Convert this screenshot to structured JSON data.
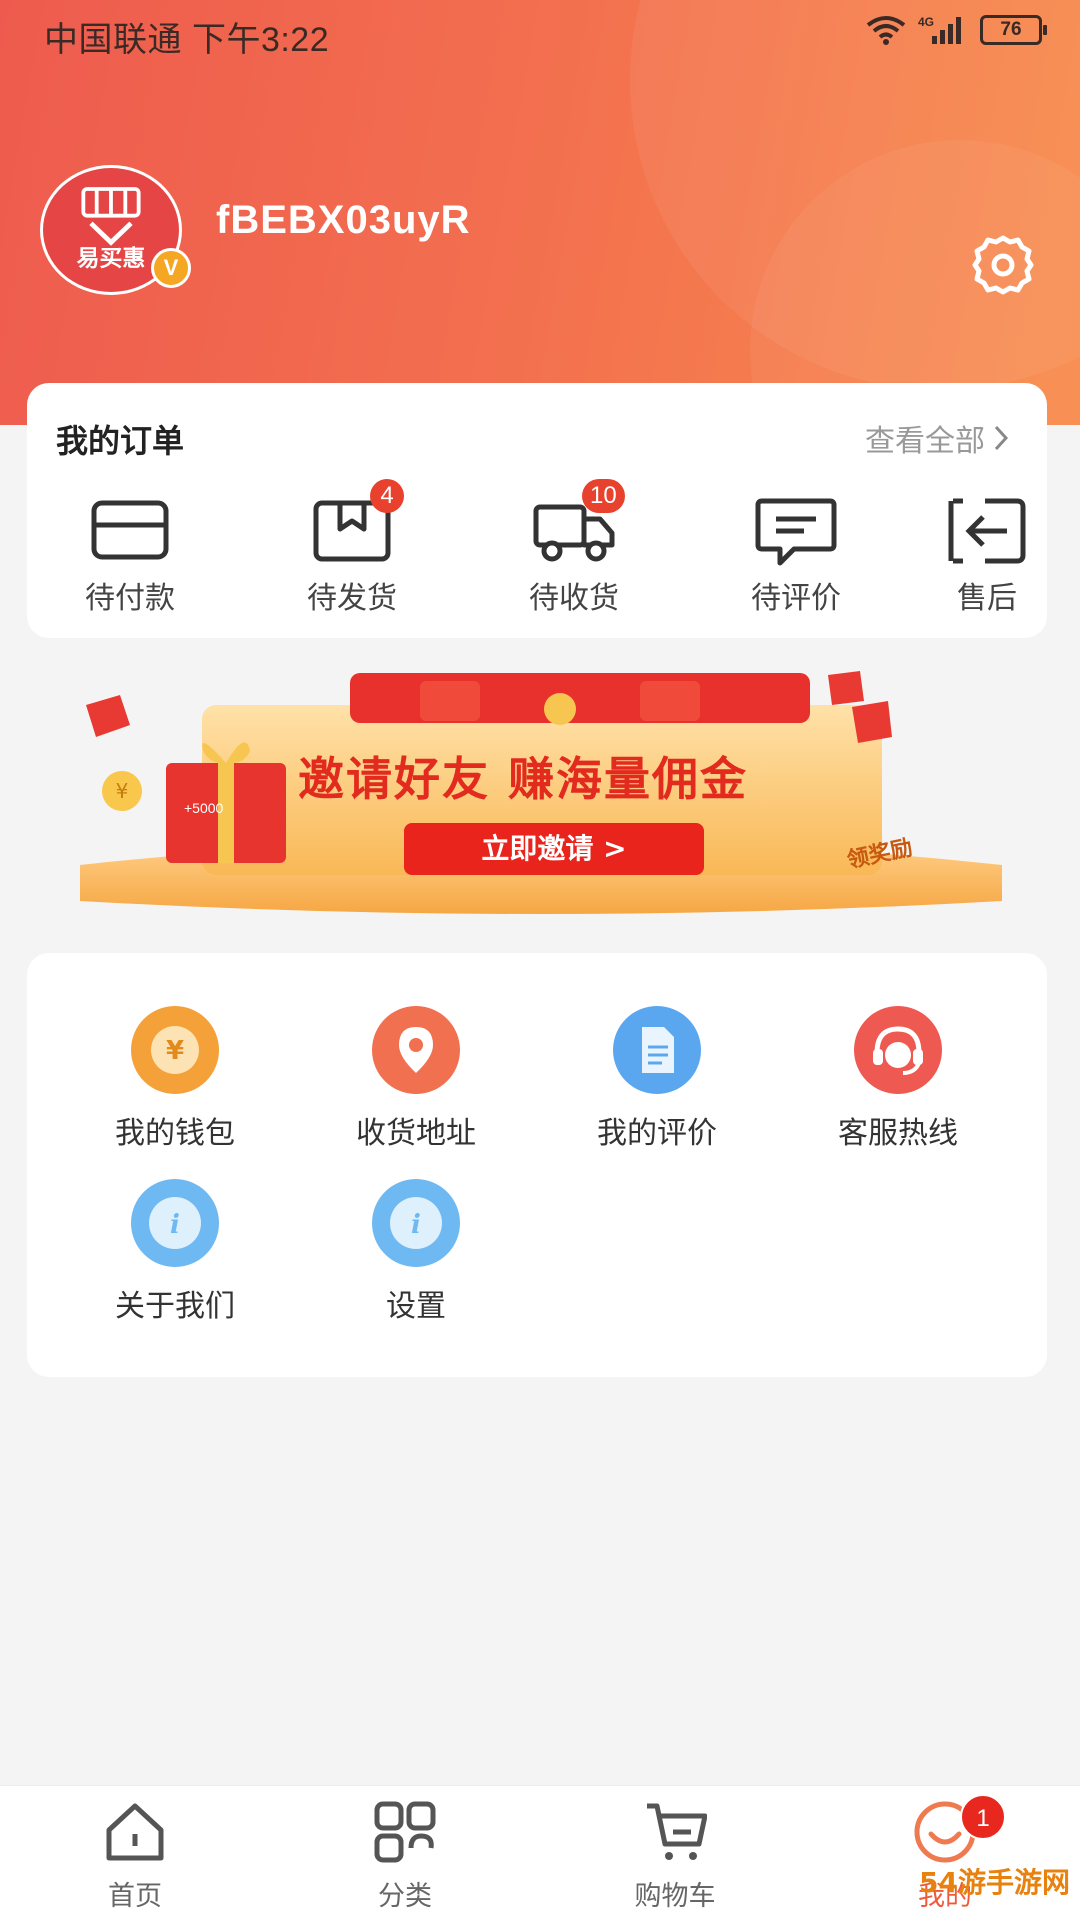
{
  "status_bar": {
    "carrier_time": "中国联通 下午3:22",
    "network": "4G",
    "battery": "76",
    "icons": [
      "wifi-icon",
      "signal-icon",
      "battery-icon"
    ]
  },
  "profile": {
    "avatar_text": "易买惠",
    "vip_badge": "V",
    "username": "fBEBX03uyR",
    "settings_icon": "gear-icon"
  },
  "orders": {
    "title": "我的订单",
    "view_all": "查看全部",
    "items": [
      {
        "label": "待付款",
        "icon": "wallet-card-icon",
        "badge": ""
      },
      {
        "label": "待发货",
        "icon": "package-box-icon",
        "badge": "4"
      },
      {
        "label": "待收货",
        "icon": "delivery-truck-icon",
        "badge": "10"
      },
      {
        "label": "待评价",
        "icon": "comment-icon",
        "badge": ""
      },
      {
        "label": "售后",
        "icon": "return-arrow-icon",
        "badge": ""
      }
    ]
  },
  "banner": {
    "headline": "邀请好友 赚海量佣金",
    "button": "立即邀请 >",
    "tag": "领奖励",
    "amount": "+5000"
  },
  "services": {
    "items": [
      {
        "label": "我的钱包",
        "icon": "yuan-coin-icon",
        "color": "#f5a13a"
      },
      {
        "label": "收货地址",
        "icon": "location-pin-icon",
        "color": "#f07050"
      },
      {
        "label": "我的评价",
        "icon": "document-icon",
        "color": "#5aa7f0"
      },
      {
        "label": "客服热线",
        "icon": "customer-service-icon",
        "color": "#ee5a52"
      },
      {
        "label": "关于我们",
        "icon": "info-icon",
        "color": "#6fb9f2"
      },
      {
        "label": "设置",
        "icon": "info-icon",
        "color": "#6fb9f2"
      }
    ]
  },
  "tab_bar": {
    "items": [
      {
        "label": "首页",
        "icon": "home-icon"
      },
      {
        "label": "分类",
        "icon": "category-grid-icon"
      },
      {
        "label": "购物车",
        "icon": "cart-icon"
      },
      {
        "label": "我的",
        "icon": "profile-smile-icon",
        "badge": "1"
      }
    ],
    "active": "我的"
  },
  "watermark": "54游手游网"
}
